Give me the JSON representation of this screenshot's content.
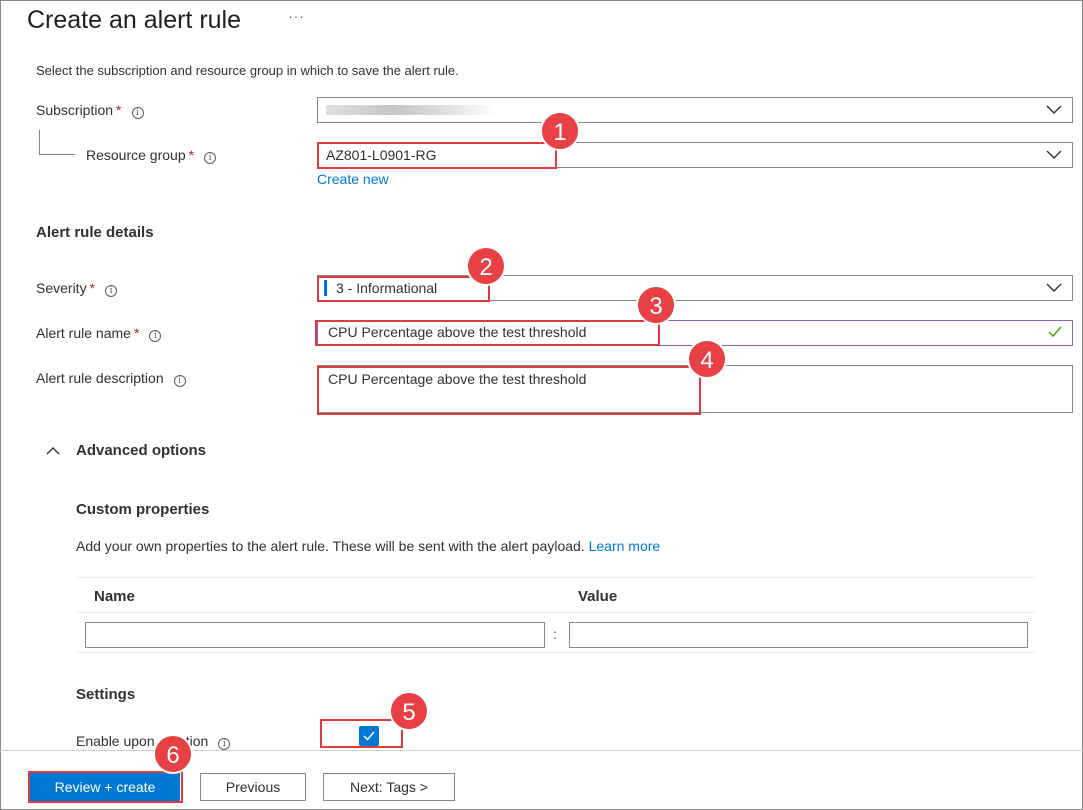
{
  "header": {
    "title": "Create an alert rule",
    "more_label": "···"
  },
  "intro": "Select the subscription and resource group in which to save the alert rule.",
  "form": {
    "subscription": {
      "label": "Subscription",
      "required": "*",
      "value": ""
    },
    "resource_group": {
      "label": "Resource group",
      "required": "*",
      "value": "AZ801-L0901-RG"
    },
    "create_new": "Create new",
    "details_heading": "Alert rule details",
    "severity": {
      "label": "Severity",
      "required": "*",
      "value": "3 - Informational"
    },
    "rule_name": {
      "label": "Alert rule name",
      "required": "*",
      "value": "CPU Percentage above the test threshold"
    },
    "rule_description": {
      "label": "Alert rule description",
      "value": "CPU Percentage above the test threshold"
    }
  },
  "advanced": {
    "toggle_label": "Advanced options",
    "custom_properties_heading": "Custom properties",
    "custom_properties_desc": "Add your own properties to the alert rule. These will be sent with the alert payload.",
    "learn_more": "Learn more",
    "columns": [
      "Name",
      "Value"
    ],
    "separator": ":",
    "settings_heading": "Settings",
    "enable_label": "Enable upon creation",
    "enable_checked": true
  },
  "footer": {
    "review_create": "Review + create",
    "previous": "Previous",
    "next": "Next: Tags >"
  },
  "callouts": [
    "1",
    "2",
    "3",
    "4",
    "5",
    "6"
  ],
  "colors": {
    "accent": "#0078d4",
    "callout": "#e74045",
    "valid": "#57a300"
  }
}
